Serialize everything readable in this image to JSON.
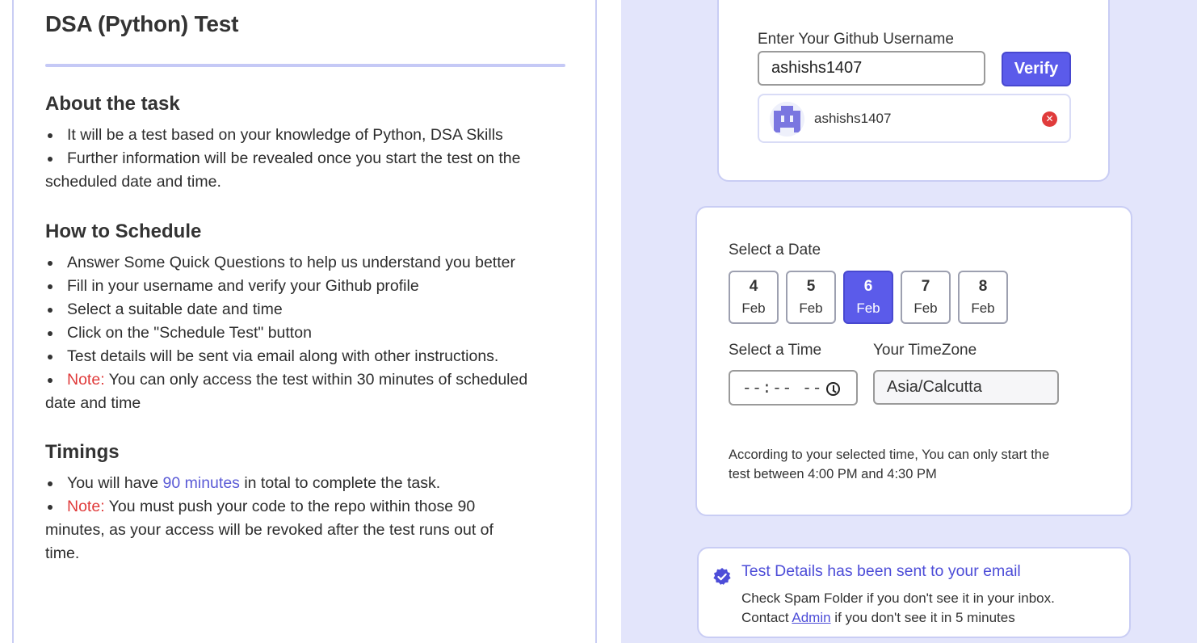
{
  "test": {
    "title": "DSA (Python) Test"
  },
  "about": {
    "heading": "About the task",
    "items": [
      "It will be a test based on your knowledge of Python, DSA Skills",
      "Further information will be revealed once you start the test on the",
      "scheduled date and time."
    ]
  },
  "schedule_howto": {
    "heading": "How to Schedule",
    "items": [
      "Answer Some Quick Questions to help us understand you better",
      "Fill in your username and verify your Github profile",
      "Select a suitable date and time",
      "Click on the \"Schedule Test\" button",
      "Test details will be sent via email along with other instructions."
    ],
    "note_label": "Note:",
    "note_text": " You can only access the test within 30 minutes of scheduled",
    "note_cont": "date and time"
  },
  "timings": {
    "heading": "Timings",
    "item1_pre": "You will have ",
    "item1_accent": "90 minutes",
    "item1_post": " in total to complete the task.",
    "note_label": "Note:",
    "note_text": " You must push your code to the repo within those 90",
    "note_cont1": "minutes, as your access will be revoked after the test runs out of",
    "note_cont2": "time."
  },
  "github": {
    "label": "Enter Your Github Username",
    "input_value": "ashishs1407",
    "verify_label": "Verify",
    "verified_username": "ashishs1407",
    "remove_glyph": "✕"
  },
  "scheduler": {
    "date_label": "Select a Date",
    "dates": [
      {
        "day": "4",
        "month": "Feb"
      },
      {
        "day": "5",
        "month": "Feb"
      },
      {
        "day": "6",
        "month": "Feb"
      },
      {
        "day": "7",
        "month": "Feb"
      },
      {
        "day": "8",
        "month": "Feb"
      }
    ],
    "selected_date_index": 2,
    "time_label": "Select a Time",
    "time_value": "--:-- --",
    "timezone_label": "Your TimeZone",
    "timezone_value": "Asia/Calcutta",
    "info_line1": "According to your selected time, You can only start the",
    "info_line2": "test between 4:00 PM and 4:30 PM"
  },
  "email_notice": {
    "title": "Test Details has been sent to your email",
    "line1": "Check Spam Folder if you don't see it in your inbox.",
    "line2_pre": "Contact ",
    "line2_link": "Admin",
    "line2_post": " if you don't see it in 5 minutes"
  },
  "colors": {
    "accent": "#5b5bea",
    "note": "#e03b3b",
    "panel_bg": "#e3e5fb"
  }
}
